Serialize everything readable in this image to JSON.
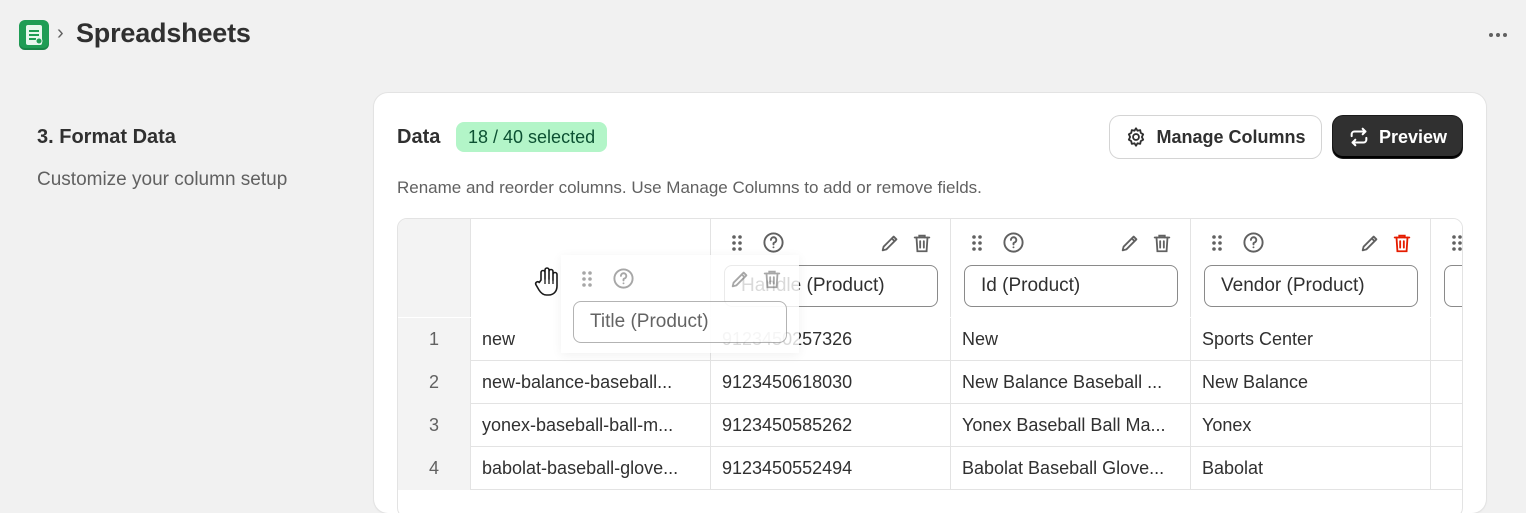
{
  "header": {
    "app_icon": "spreadsheet-app-icon",
    "chevron": "›",
    "title": "Spreadsheets",
    "more_icon": "more-horizontal-icon"
  },
  "section": {
    "title": "3. Format Data",
    "subtitle": "Customize your column setup"
  },
  "card": {
    "title": "Data",
    "badge": "18 / 40 selected",
    "manage_label": "Manage Columns",
    "preview_label": "Preview",
    "description": "Rename and reorder columns. Use Manage Columns to add or remove fields."
  },
  "columns": [
    {
      "label": "Title (Product)",
      "dragging": true
    },
    {
      "label": "Handle (Product)"
    },
    {
      "label": "Id (Product)"
    },
    {
      "label": "Vendor (Product)",
      "delete_color": "#e51c00"
    },
    {
      "label": ""
    }
  ],
  "rows": [
    {
      "num": "1",
      "cells": [
        "new",
        "9123450257326",
        "New",
        "Sports Center"
      ]
    },
    {
      "num": "2",
      "cells": [
        "new-balance-baseball...",
        "9123450618030",
        "New Balance Baseball ...",
        "New Balance"
      ]
    },
    {
      "num": "3",
      "cells": [
        "yonex-baseball-ball-m...",
        "9123450585262",
        "Yonex Baseball Ball Ma...",
        "Yonex"
      ]
    },
    {
      "num": "4",
      "cells": [
        "babolat-baseball-glove...",
        "9123450552494",
        "Babolat Baseball Glove...",
        "Babolat"
      ]
    }
  ],
  "colors": {
    "accent_green": "#1f9d55",
    "badge_bg": "#b3f5c8",
    "badge_text": "#0c5132",
    "primary_button": "#303030",
    "danger": "#e51c00"
  }
}
